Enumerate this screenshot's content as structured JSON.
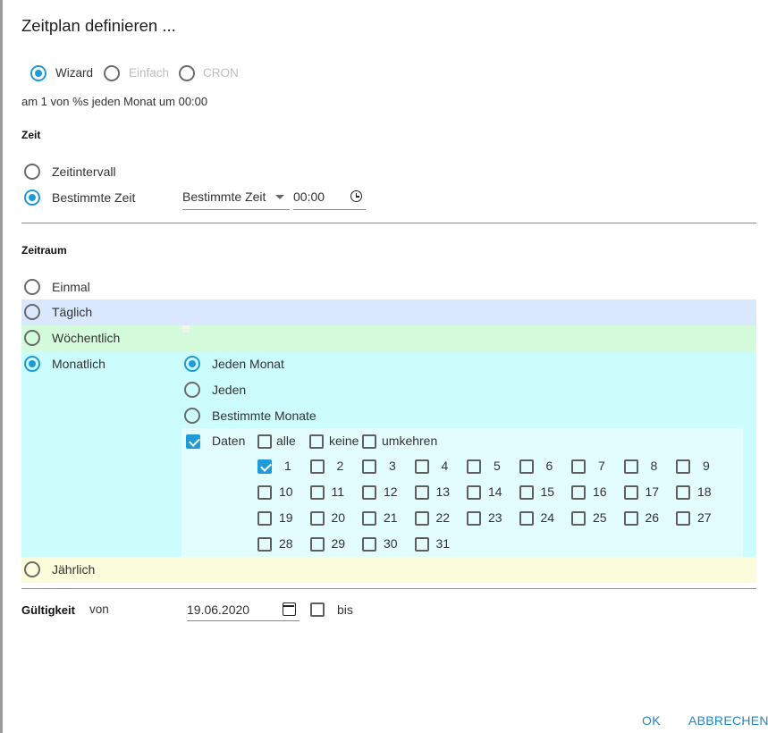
{
  "dialog": {
    "title": "Zeitplan definieren ...",
    "ok_label": "OK",
    "cancel_label": "ABBRECHEN"
  },
  "mode": {
    "options": [
      "Wizard",
      "Einfach",
      "CRON"
    ],
    "selected": "Wizard"
  },
  "summary": "am 1 von %s jeden Monat um 00:00",
  "zeit": {
    "heading": "Zeit",
    "options": [
      "Zeitintervall",
      "Bestimmte Zeit"
    ],
    "selected": "Bestimmte Zeit",
    "select_value": "Bestimmte Zeit",
    "time_value": "00:00"
  },
  "zeitraum": {
    "heading": "Zeitraum",
    "options": [
      "Einmal",
      "Täglich",
      "Wöchentlich",
      "Monatlich",
      "Jährlich"
    ],
    "selected": "Monatlich",
    "colors": {
      "taeglich": "#d9e8fc",
      "woechentlich": "#d4fbdc",
      "monatlich": "#ccfcfc",
      "monatlich_inner": "#e3fcfc",
      "jaehrlich": "#fbfcdc"
    }
  },
  "monthly": {
    "options": [
      "Jeden Monat",
      "Jeden",
      "Bestimmte Monate"
    ],
    "selected": "Jeden Monat",
    "dates_label": "Daten",
    "dates_checked": true,
    "all_label": "alle",
    "none_label": "keine",
    "invert_label": "umkehren",
    "days": [
      "1",
      "2",
      "3",
      "4",
      "5",
      "6",
      "7",
      "8",
      "9",
      "10",
      "11",
      "12",
      "13",
      "14",
      "15",
      "16",
      "17",
      "18",
      "19",
      "20",
      "21",
      "22",
      "23",
      "24",
      "25",
      "26",
      "27",
      "28",
      "29",
      "30",
      "31"
    ],
    "checked_days": [
      "1"
    ]
  },
  "validity": {
    "label": "Gültigkeit",
    "from_label": "von",
    "from_value": "19.06.2020",
    "to_label": "bis",
    "to_checked": false
  },
  "accent_color": "#1e9bd7"
}
